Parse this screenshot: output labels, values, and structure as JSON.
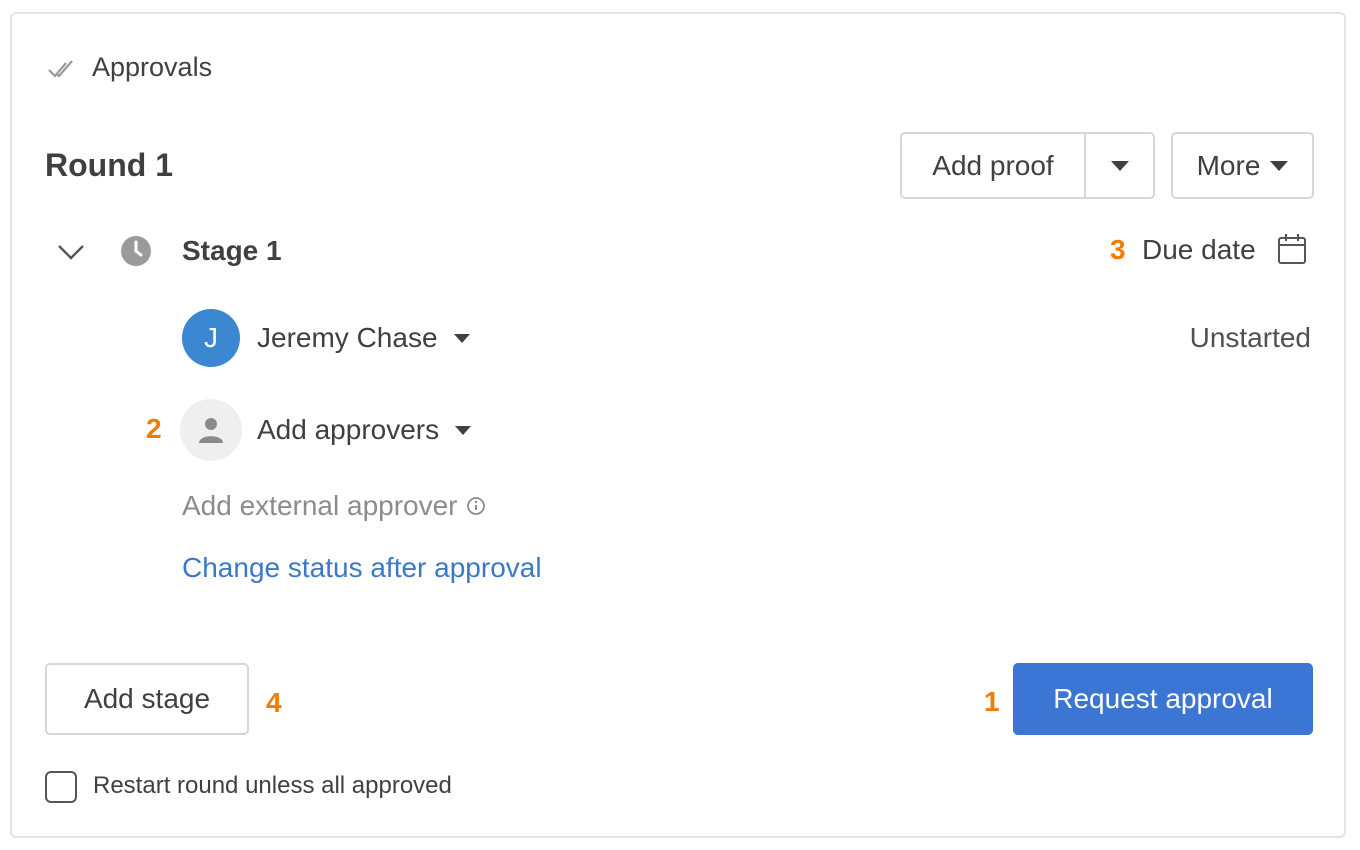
{
  "header": {
    "icon": "double-check-icon",
    "title": "Approvals"
  },
  "round": {
    "title": "Round 1",
    "add_proof_label": "Add proof",
    "more_label": "More"
  },
  "stage": {
    "title": "Stage 1",
    "due_date_label": "Due date",
    "approver": {
      "initial": "J",
      "name": "Jeremy Chase",
      "status": "Unstarted",
      "avatar_color": "#3b87d0"
    },
    "add_approvers_label": "Add approvers",
    "add_external_label": "Add external approver",
    "change_status_link": "Change status after approval"
  },
  "footer": {
    "add_stage_label": "Add stage",
    "request_approval_label": "Request approval",
    "restart_label": "Restart round unless all approved",
    "restart_checked": false
  },
  "annotations": {
    "n1": "1",
    "n2": "2",
    "n3": "3",
    "n4": "4"
  },
  "colors": {
    "accent": "#3b76d4",
    "link": "#3c78c8",
    "annotation": "#f07c00"
  }
}
